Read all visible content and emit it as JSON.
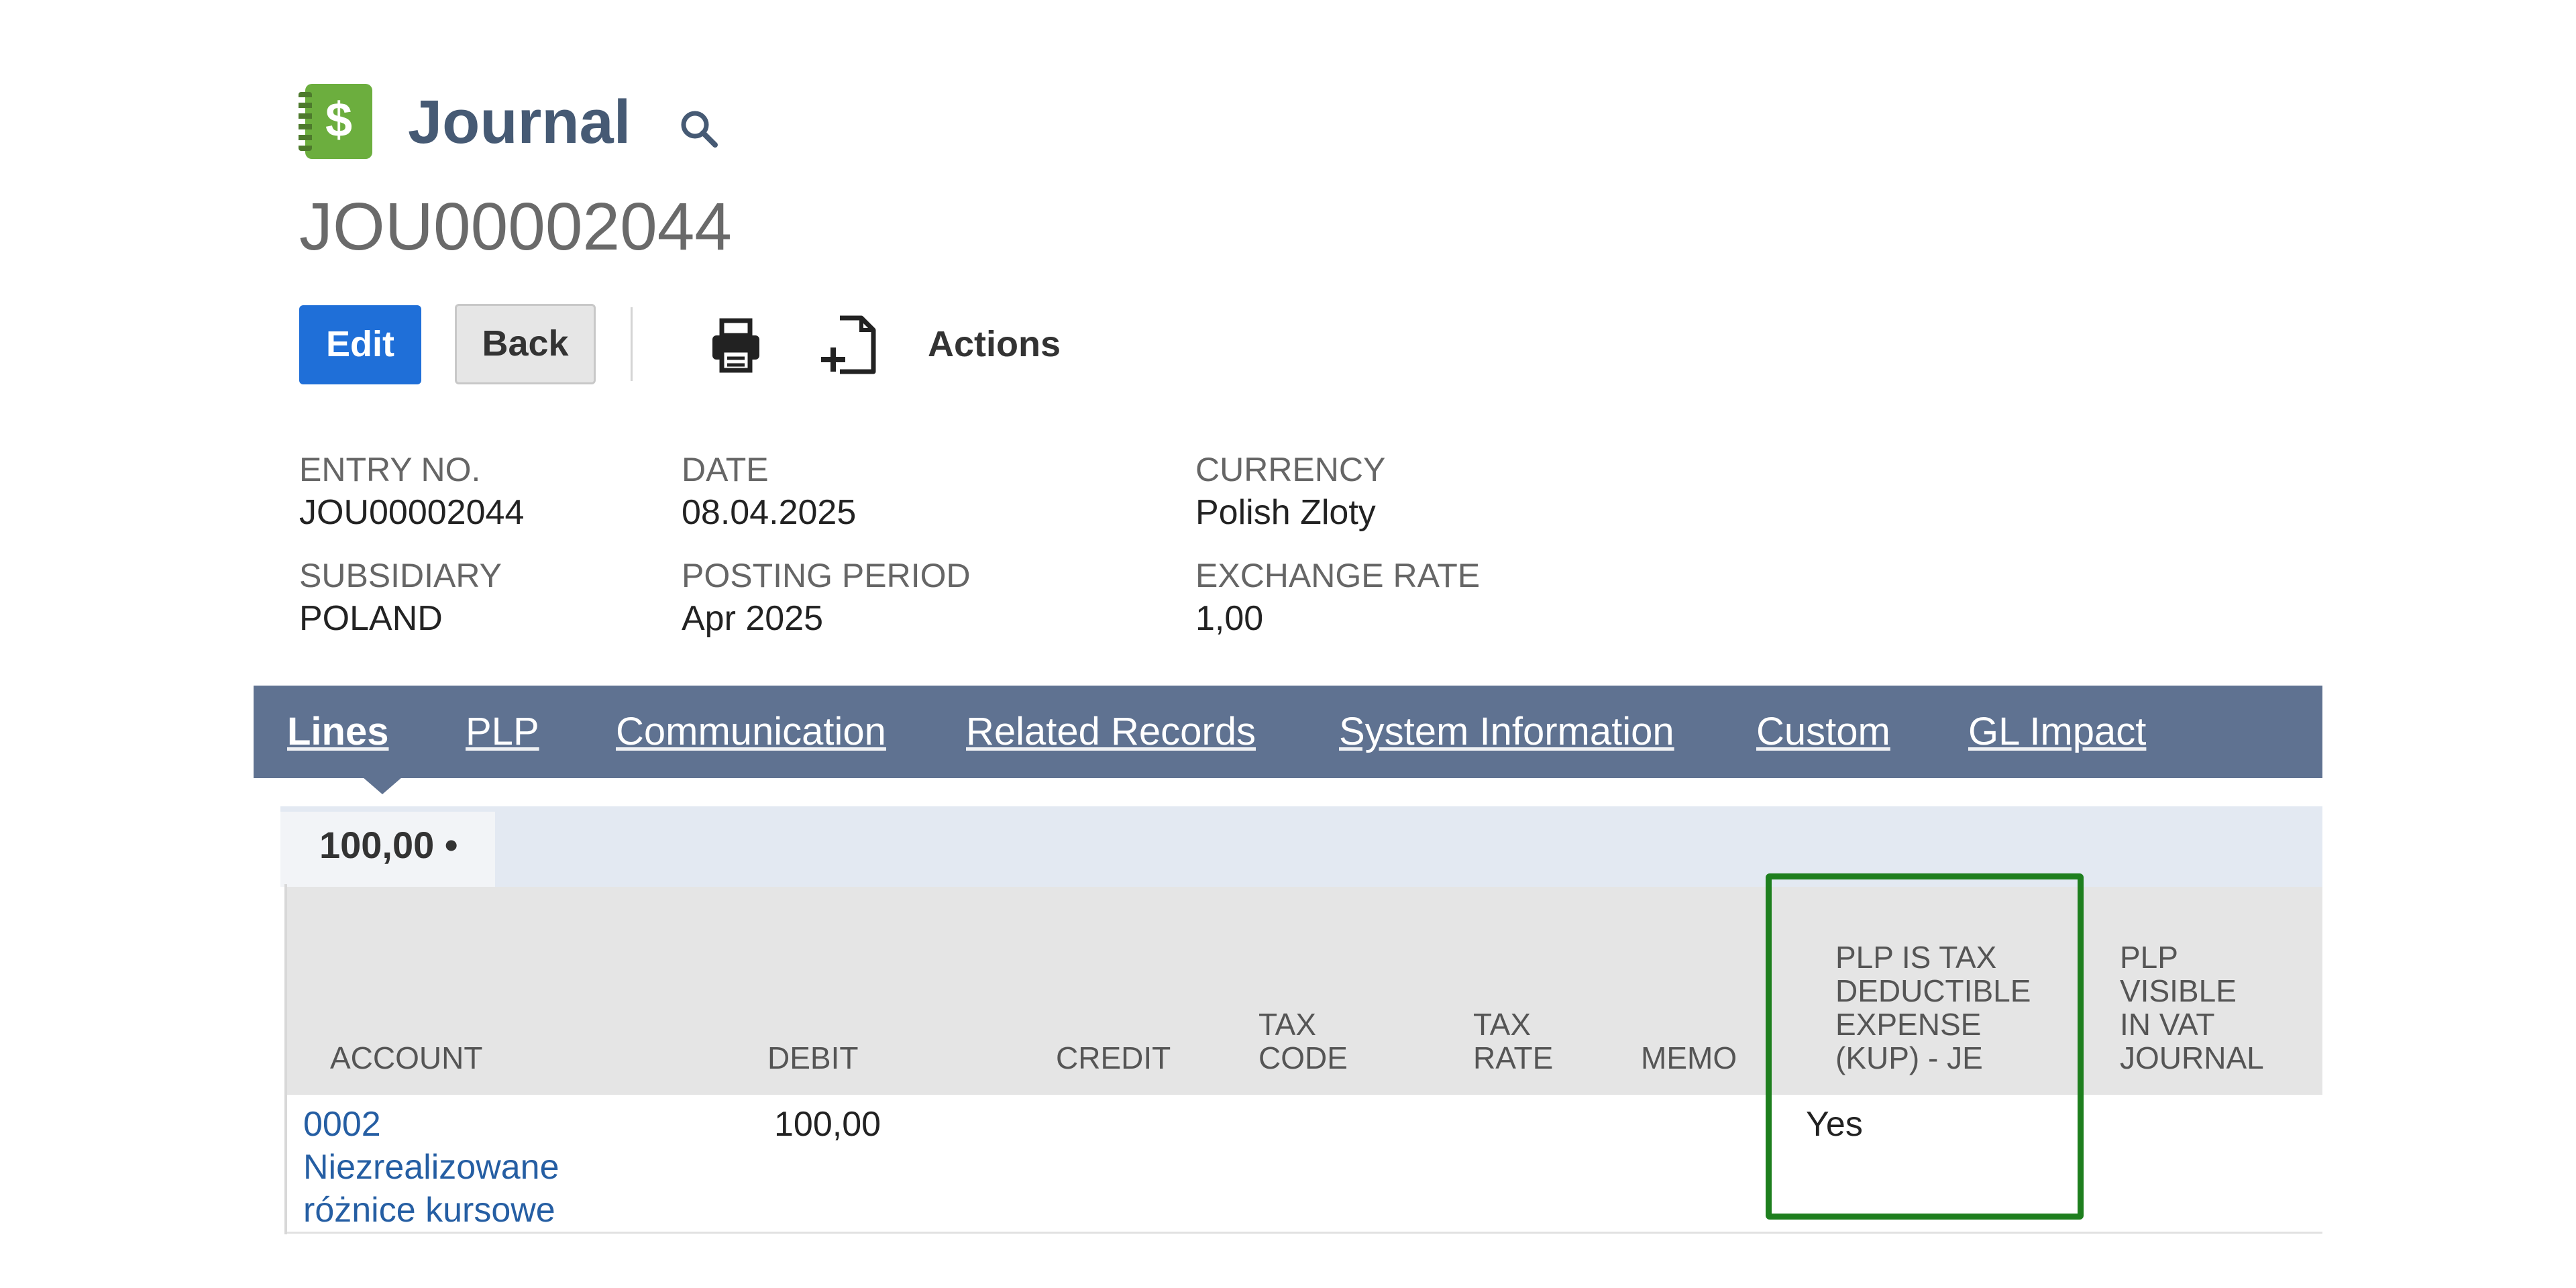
{
  "header": {
    "title": "Journal",
    "record_id": "JOU00002044",
    "icon": "dollar-journal-icon"
  },
  "toolbar": {
    "edit_label": "Edit",
    "back_label": "Back",
    "actions_label": "Actions",
    "print_icon": "print-icon",
    "new_doc_icon": "new-document-icon"
  },
  "fields": {
    "entry_no": {
      "label": "ENTRY NO.",
      "value": "JOU00002044"
    },
    "date": {
      "label": "DATE",
      "value": "08.04.2025"
    },
    "currency": {
      "label": "CURRENCY",
      "value": "Polish Zloty"
    },
    "subsidiary": {
      "label": "SUBSIDIARY",
      "value": "POLAND"
    },
    "posting_period": {
      "label": "POSTING PERIOD",
      "value": "Apr 2025"
    },
    "exchange_rate": {
      "label": "EXCHANGE RATE",
      "value": "1,00"
    }
  },
  "tabs": [
    {
      "label": "Lines",
      "active": true
    },
    {
      "label": "PLP",
      "active": false
    },
    {
      "label": "Communication",
      "active": false
    },
    {
      "label": "Related Records",
      "active": false
    },
    {
      "label": "System Information",
      "active": false
    },
    {
      "label": "Custom",
      "active": false
    },
    {
      "label": "GL Impact",
      "active": false
    }
  ],
  "subtab": {
    "label": "100,00 •"
  },
  "grid": {
    "columns": [
      {
        "key": "account",
        "lines": [
          "ACCOUNT"
        ]
      },
      {
        "key": "debit",
        "lines": [
          "DEBIT"
        ]
      },
      {
        "key": "credit",
        "lines": [
          "CREDIT"
        ]
      },
      {
        "key": "tax_code",
        "lines": [
          "TAX",
          "CODE"
        ]
      },
      {
        "key": "tax_rate",
        "lines": [
          "TAX",
          "RATE"
        ]
      },
      {
        "key": "memo",
        "lines": [
          "MEMO"
        ]
      },
      {
        "key": "plp_kup",
        "lines": [
          "PLP IS TAX",
          "DEDUCTIBLE",
          "EXPENSE",
          "(KUP) - JE"
        ]
      },
      {
        "key": "plp_vat",
        "lines": [
          "PLP",
          "VISIBLE",
          "IN VAT",
          "JOURNAL"
        ]
      }
    ],
    "rows": [
      {
        "account_lines": [
          "0002",
          "Niezrealizowane",
          "różnice kursowe"
        ],
        "debit": "100,00",
        "credit": "",
        "tax_code": "",
        "tax_rate": "",
        "memo": "",
        "plp_kup": "Yes",
        "plp_vat": ""
      }
    ]
  },
  "colors": {
    "tabbar": "#5f7291",
    "edit_button": "#1f6fd8",
    "title": "#465a74",
    "link": "#255ea3",
    "highlight": "#1e7f1e",
    "icon_green": "#6cae3e"
  }
}
